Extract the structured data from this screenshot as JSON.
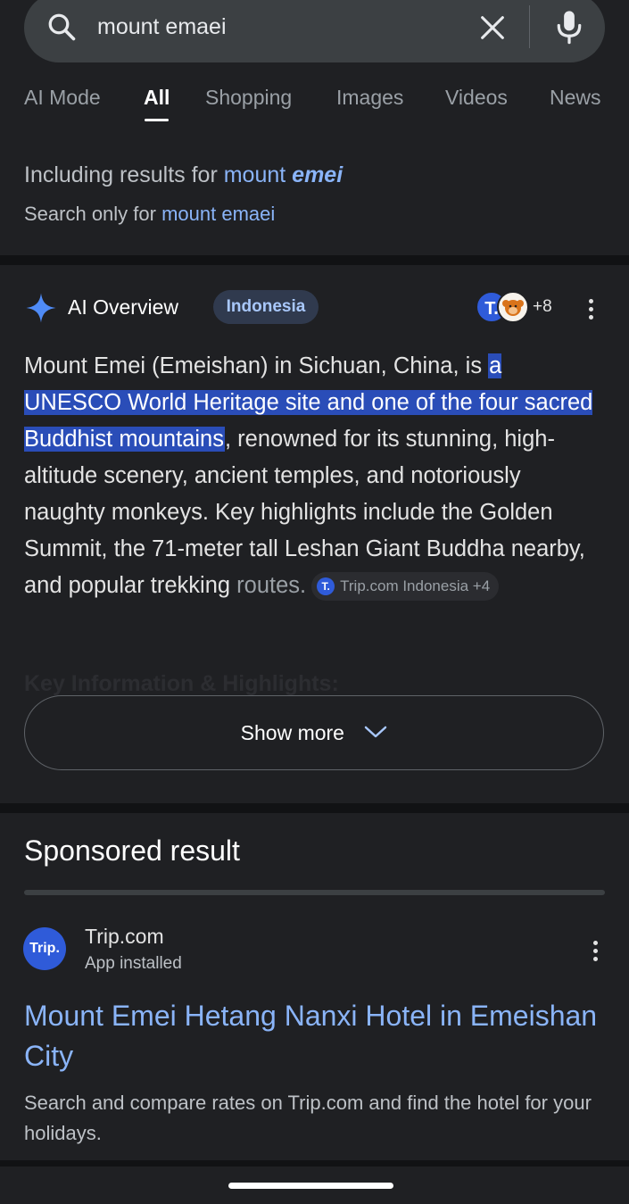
{
  "search": {
    "query": "mount emaei",
    "icons": [
      "search-icon",
      "clear-icon",
      "mic-icon"
    ]
  },
  "tabs": [
    {
      "label": "AI Mode",
      "active": false
    },
    {
      "label": "All",
      "active": true
    },
    {
      "label": "Shopping",
      "active": false
    },
    {
      "label": "Images",
      "active": false
    },
    {
      "label": "Videos",
      "active": false
    },
    {
      "label": "News",
      "active": false
    }
  ],
  "spelling": {
    "including_prefix": "Including results for",
    "corrected_plain": "mount",
    "corrected_bold": "emei",
    "only_prefix": "Search only for",
    "original_query": "mount emaei"
  },
  "ai_overview": {
    "title": "AI Overview",
    "chip": "Indonesia",
    "source_avatar_letter": "T.",
    "source_count": "+8",
    "text_before": "Mount Emei (Emeishan) in Sichuan, China, is ",
    "text_highlight": "a UNESCO World Heritage site and one of the four sacred Buddhist mountains",
    "text_after": ", renowned for its stunning, high-altitude scenery, ancient temples, and notoriously naughty monkeys. Key highlights include the Golden Summit, the 71-meter tall Leshan Giant Buddha nearby, and popular trekking ",
    "text_faded": "routes.",
    "source_chip_letter": "T.",
    "source_chip": "Trip.com Indonesia +4",
    "faded_heading": "Key Information & Highlights:",
    "show_more": "Show more"
  },
  "sponsored": {
    "heading": "Sponsored result",
    "logo_text": "Trip.",
    "advertiser": "Trip.com",
    "advertiser_sub": "App installed",
    "title": "Mount Emei Hetang Nanxi Hotel in Emeishan City",
    "description": "Search and compare rates on Trip.com and find the hotel for your holidays."
  },
  "colors": {
    "background": "#1f2023",
    "link": "#8ab4f8",
    "highlight": "#2a4db8",
    "chip_bg": "#303a4e"
  }
}
